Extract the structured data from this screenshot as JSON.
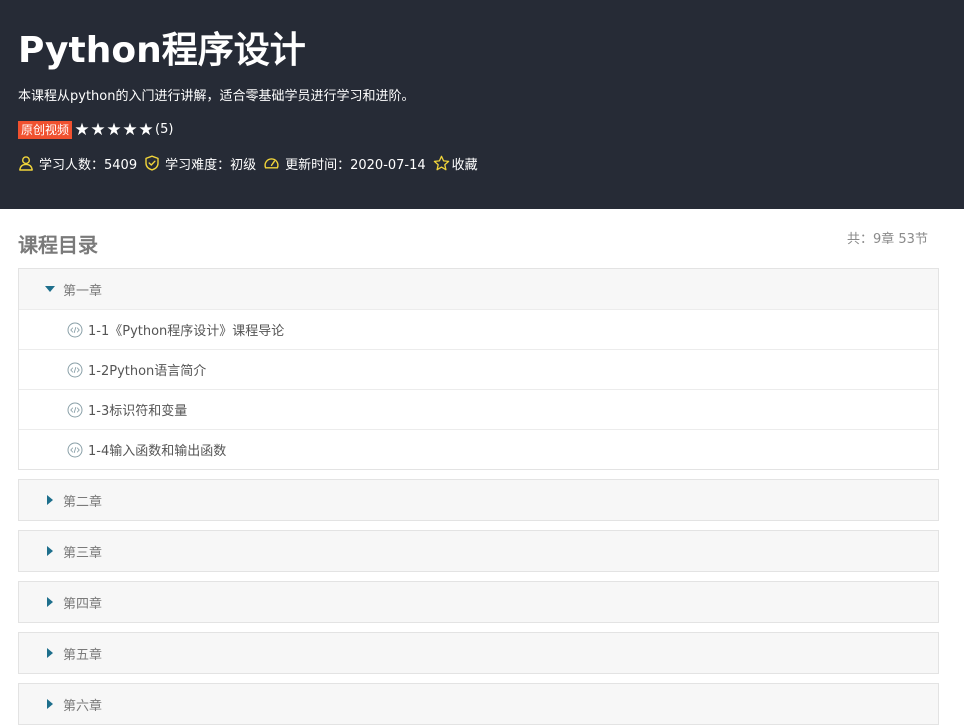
{
  "course": {
    "title": "Python程序设计",
    "description": "本课程从python的入门进行讲解，适合零基础学员进行学习和进阶。",
    "badge": "原创视频",
    "rating_stars": 5,
    "star_glyph": "★",
    "rating_count": "(5)",
    "meta": {
      "learners": "学习人数：5409",
      "difficulty": "学习难度：初级",
      "updated": "更新时间：2020-07-14",
      "favorite": "收藏"
    }
  },
  "catalog": {
    "title": "课程目录",
    "count": "共：9章 53节",
    "chapters": [
      {
        "name": "第一章",
        "expanded": true,
        "lessons": [
          "1-1《Python程序设计》课程导论",
          "1-2Python语言简介",
          "1-3标识符和变量",
          "1-4输入函数和输出函数"
        ]
      },
      {
        "name": "第二章",
        "expanded": false
      },
      {
        "name": "第三章",
        "expanded": false
      },
      {
        "name": "第四章",
        "expanded": false
      },
      {
        "name": "第五章",
        "expanded": false
      },
      {
        "name": "第六章",
        "expanded": false
      }
    ]
  },
  "icons": {
    "meta_icon_color": "#f0d43a",
    "triangle_color": "#1e6f8c",
    "lesson_icon_color": "#8aa0a8"
  },
  "colors": {
    "header_bg": "#262b36",
    "badge_bg": "#f0512f"
  }
}
